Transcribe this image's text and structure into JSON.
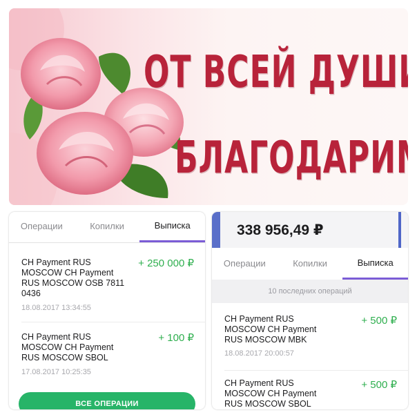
{
  "banner": {
    "line1": "ОТ ВСЕЙ ДУШИ",
    "line2": "БЛАГОДАРИМ!"
  },
  "left_card": {
    "tabs": [
      {
        "label": "Операции"
      },
      {
        "label": "Копилки"
      },
      {
        "label": "Выписка",
        "active": true
      }
    ],
    "operations": [
      {
        "title": "CH Payment RUS MOSCOW CH Payment RUS MOSCOW OSB 7811 0436",
        "amount": "+ 250 000 ₽",
        "date": "18.08.2017  13:34:55"
      },
      {
        "title": "CH Payment RUS MOSCOW CH Payment RUS MOSCOW SBOL",
        "amount": "+ 100 ₽",
        "date": "17.08.2017  10:25:35"
      }
    ],
    "all_button": "ВСЕ ОПЕРАЦИИ"
  },
  "right_card": {
    "balance": "338 956,49 ₽",
    "tabs": [
      {
        "label": "Операции"
      },
      {
        "label": "Копилки"
      },
      {
        "label": "Выписка",
        "active": true
      }
    ],
    "last_ops_label": "10 последних операций",
    "operations": [
      {
        "title": "CH Payment RUS MOSCOW CH Payment RUS MOSCOW MBK",
        "amount": "+ 500 ₽",
        "date": "18.08.2017  20:00:57"
      },
      {
        "title": "CH Payment RUS MOSCOW CH Payment RUS MOSCOW SBOL",
        "amount": "+ 500 ₽",
        "date": ""
      }
    ]
  },
  "colors": {
    "banner_text": "#b8233a",
    "amount_green": "#2faf4f",
    "button_green": "#27b468",
    "tab_underline": "#7b5cd6",
    "balance_accent": "#5a6fc9"
  },
  "icons": [
    "rose-icon",
    "leaf-icon"
  ]
}
